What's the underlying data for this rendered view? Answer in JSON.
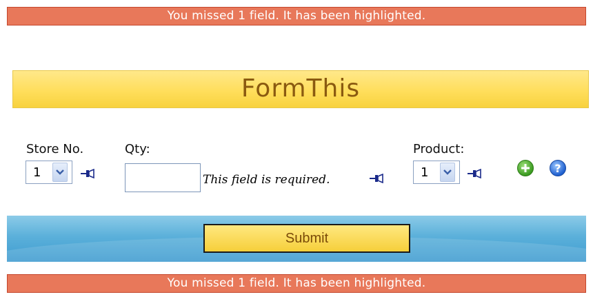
{
  "alerts": {
    "top": "You missed 1 field. It has been highlighted.",
    "bottom": "You missed 1 field. It has been highlighted."
  },
  "form": {
    "title": "FormThis",
    "store": {
      "label": "Store No.",
      "selected": "1"
    },
    "qty": {
      "label": "Qty:",
      "value": "",
      "error": "This field is required."
    },
    "product": {
      "label": "Product:",
      "selected": "1"
    },
    "submit_label": "Submit"
  },
  "icons": {
    "pin": "pin-icon",
    "dropdown": "chevron-down-icon",
    "add": "plus-icon",
    "help": "help-icon"
  },
  "colors": {
    "alert_bg": "#e8785a",
    "title_bg": "#ffde5c",
    "title_text": "#8a5a10",
    "band_bg": "#5bb0da",
    "submit_bg": "#f6cf3a",
    "submit_text": "#7a4a08"
  }
}
